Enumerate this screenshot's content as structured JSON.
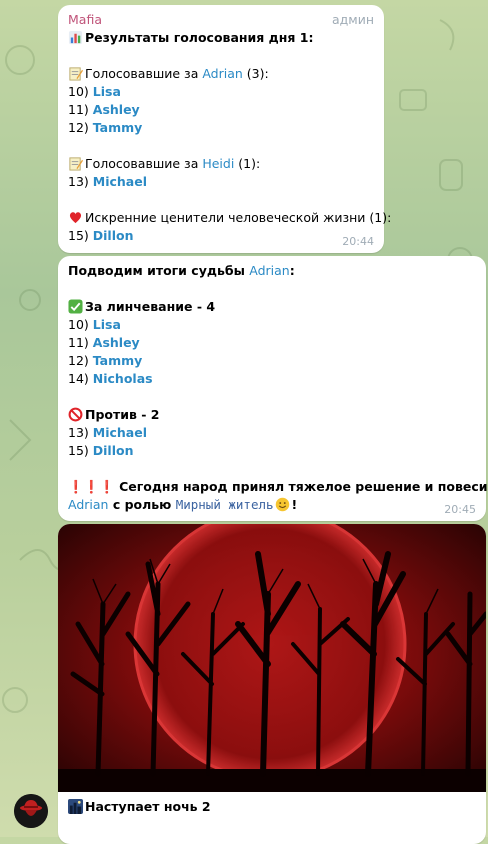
{
  "msg1": {
    "sender": "Mafia",
    "role": "админ",
    "title": "Результаты голосования дня 1:",
    "g1_prefix": "Голосовавшие за ",
    "g1_name": "Adrian",
    "g1_suffix": " (3):",
    "g1_rows": [
      {
        "num": "10) ",
        "name": "Lisa"
      },
      {
        "num": "11) ",
        "name": "Ashley"
      },
      {
        "num": "12) ",
        "name": "Tammy"
      }
    ],
    "g2_prefix": "Голосовавшие за ",
    "g2_name": "Heidi",
    "g2_suffix": " (1):",
    "g2_rows": [
      {
        "num": "13) ",
        "name": "Michael"
      }
    ],
    "g3_text": "Искренние ценители человеческой жизни (1):",
    "g3_rows": [
      {
        "num": "15) ",
        "name": "Dillon"
      }
    ],
    "time": "20:44"
  },
  "msg2": {
    "title_prefix": "Подводим итоги судьбы ",
    "title_name": "Adrian",
    "title_suffix": ":",
    "for_text": "За линчевание - 4",
    "for_rows": [
      {
        "num": "10) ",
        "name": "Lisa"
      },
      {
        "num": "11) ",
        "name": "Ashley"
      },
      {
        "num": "12) ",
        "name": "Tammy"
      },
      {
        "num": "14) ",
        "name": "Nicholas"
      }
    ],
    "against_text": "Против - 2",
    "against_rows": [
      {
        "num": "13) ",
        "name": "Michael"
      },
      {
        "num": "15) ",
        "name": "Dillon"
      }
    ],
    "excl": "❗❗❗",
    "verdict": "Сегодня народ принял тяжелое решение и повесил",
    "verdict_name": "Adrian",
    "verdict_role_prefix": " с ролью ",
    "verdict_role": "Мирный житель",
    "verdict_end": "!",
    "time": "20:45"
  },
  "msg3": {
    "caption": "Наступает ночь 2"
  },
  "colors": {
    "sender": "#c0547a",
    "link": "#2b8ac5",
    "time": "#a0acb6"
  },
  "icons": [
    "bar-chart-icon",
    "memo-icon",
    "red-heart-icon",
    "check-mark-icon",
    "prohibited-icon",
    "exclamation-icon",
    "smile-icon",
    "night-city-icon",
    "avatar"
  ]
}
